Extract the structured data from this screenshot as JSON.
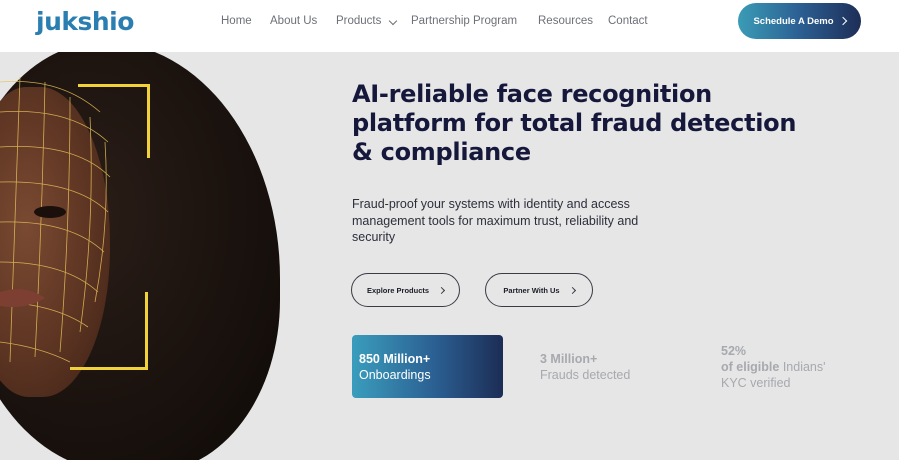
{
  "brand": {
    "logo": "jukshio",
    "accent": "#2b7fb0"
  },
  "nav": {
    "home": "Home",
    "about": "About Us",
    "products": "Products",
    "partnership": "Partnership Program",
    "resources": "Resources",
    "contact": "Contact"
  },
  "header": {
    "demo_button": "Schedule A Demo"
  },
  "hero": {
    "headline": "AI-reliable face recognition platform for total fraud detection & compliance",
    "subtext": "Fraud-proof your systems with identity and access management tools for maximum trust, reliability and security",
    "explore_button": "Explore Products",
    "partner_button": "Partner With Us"
  },
  "stats": [
    {
      "value": "850 Million+",
      "label": "Onboardings"
    },
    {
      "value": "3 Million+",
      "label": "Frauds detected"
    },
    {
      "value": "52%",
      "label_bold": "of eligible",
      "label": "Indians'",
      "label2": "KYC verified"
    }
  ],
  "icons": {
    "products_dropdown": "chevron-down-icon",
    "cta_arrow": "chevron-right-icon"
  },
  "colors": {
    "bracket": "#f2d23a",
    "heading": "#15183a",
    "muted": "#a7a9ae"
  }
}
